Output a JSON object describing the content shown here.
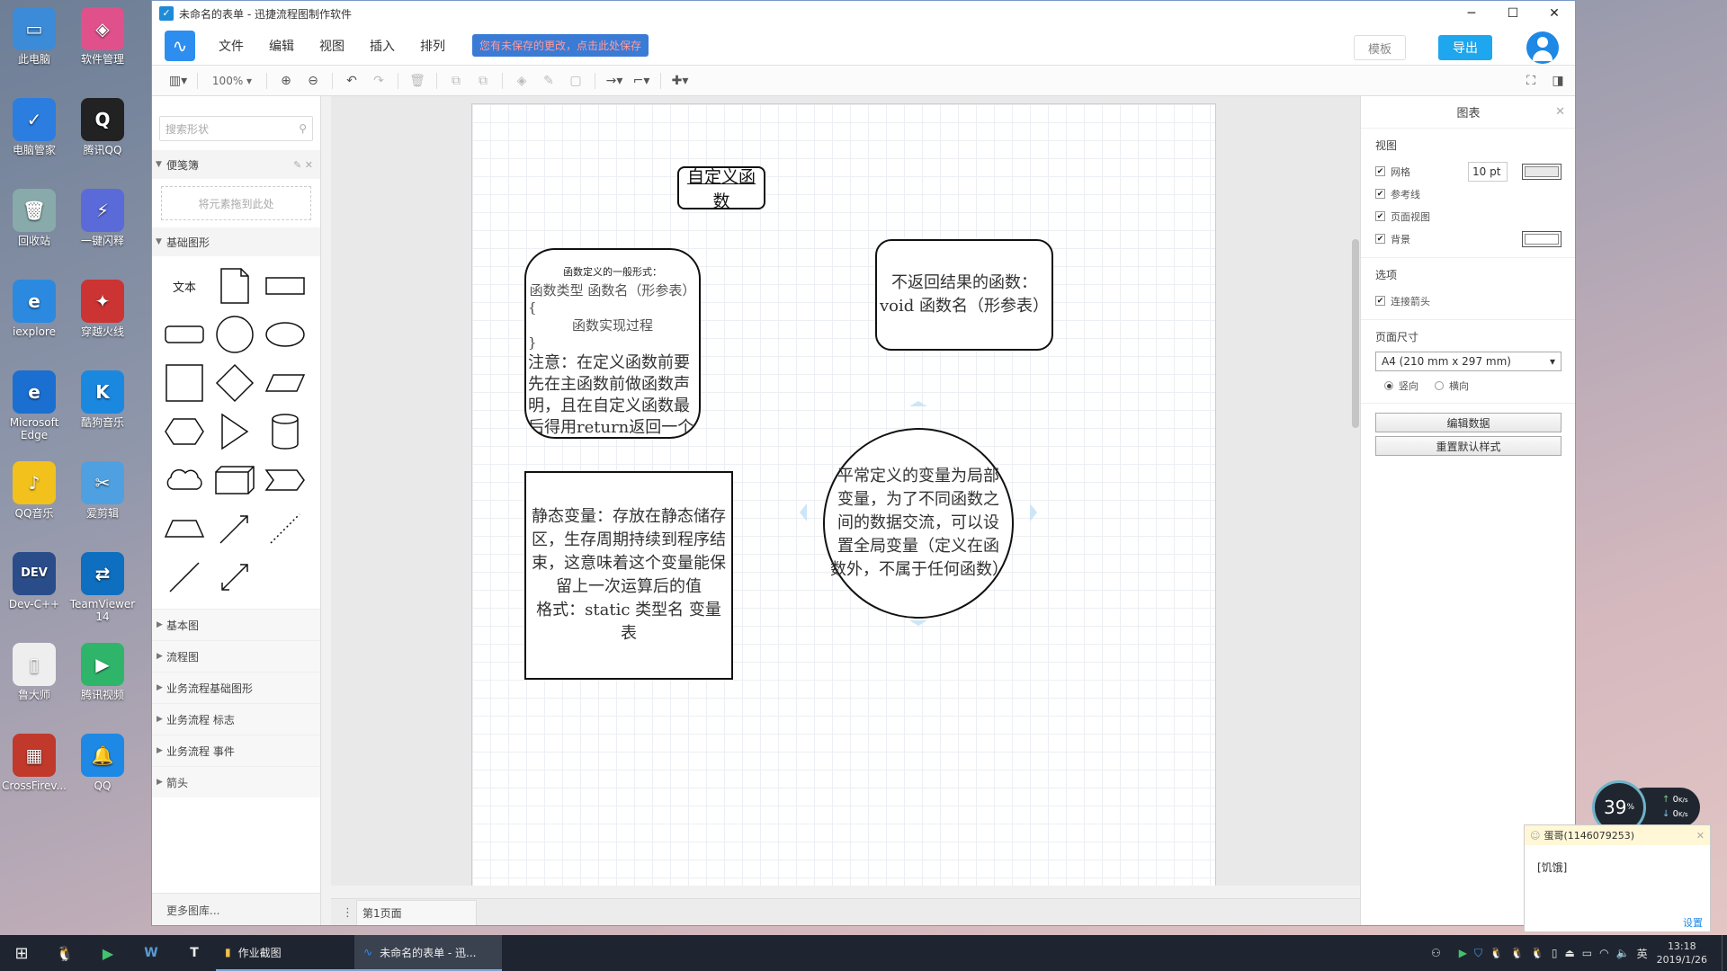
{
  "desktop": {
    "icons": [
      {
        "label": "此电脑",
        "color": "#3b8bd9",
        "glyph": "▭"
      },
      {
        "label": "软件管理",
        "color": "#e0508a",
        "glyph": "◈"
      },
      {
        "label": "电脑管家",
        "color": "#2b7de0",
        "glyph": "✓"
      },
      {
        "label": "腾讯QQ",
        "color": "#222",
        "glyph": "Q"
      },
      {
        "label": "回收站",
        "color": "#8aa",
        "glyph": "🗑"
      },
      {
        "label": "一键闪释",
        "color": "#5a6ad8",
        "glyph": "⚡"
      },
      {
        "label": "iexplore",
        "color": "#2b8ae0",
        "glyph": "e"
      },
      {
        "label": "穿越火线",
        "color": "#c33",
        "glyph": "✦"
      },
      {
        "label": "Microsoft Edge",
        "color": "#1a6fd1",
        "glyph": "e"
      },
      {
        "label": "酷狗音乐",
        "color": "#1b88e0",
        "glyph": "K"
      },
      {
        "label": "QQ音乐",
        "color": "#f2c11c",
        "glyph": "♪"
      },
      {
        "label": "爱剪辑",
        "color": "#4fa0e0",
        "glyph": "✂"
      },
      {
        "label": "Dev-C++",
        "color": "#2a4d8a",
        "glyph": "DEV"
      },
      {
        "label": "TeamViewer 14",
        "color": "#0e6ebf",
        "glyph": "⇄"
      },
      {
        "label": "鲁大师",
        "color": "#eee",
        "glyph": "▯"
      },
      {
        "label": "腾讯视频",
        "color": "#2fb56a",
        "glyph": "▶"
      },
      {
        "label": "CrossFirev...",
        "color": "#c0392b",
        "glyph": "▦"
      },
      {
        "label": "QQ",
        "color": "#1e88e5",
        "glyph": "🔔"
      }
    ]
  },
  "app": {
    "window_title": "未命名的表单 - 迅捷流程图制作软件",
    "menu": [
      "文件",
      "编辑",
      "视图",
      "插入",
      "排列"
    ],
    "notice": "您有未保存的更改，点击此处保存",
    "template_btn": "模板",
    "export_btn": "导出",
    "zoom": "100%"
  },
  "left": {
    "search_placeholder": "搜索形状",
    "scratchpad_title": "便笺簿",
    "scratchpad_hint": "将元素拖到此处",
    "basic_title": "基础图形",
    "text_shape": "文本",
    "categories": [
      "基本图",
      "流程图",
      "业务流程基础图形",
      "业务流程 标志",
      "业务流程 事件",
      "箭头"
    ],
    "more": "更多图库..."
  },
  "diagram": {
    "title": "自定义函数",
    "box1": {
      "small": "函数定义的一般形式：",
      "line1": "函数类型  函数名（形参表）",
      "line2": "{",
      "line3": "函数实现过程",
      "line4": "}",
      "note": "注意：在定义函数前要先在主函数前做函数声明，且在自定义函数最后得用return返回一个值"
    },
    "box2": {
      "line1": "不返回结果的函数：",
      "line2": "void  函数名（形参表）"
    },
    "box3": {
      "text": "静态变量：存放在静态储存区，生存周期持续到程序结束，这意味着这个变量能保留上一次运算后的值",
      "format": "格式：static  类型名  变量表"
    },
    "circle": {
      "text": "平常定义的变量为局部变量，为了不同函数之间的数据交流，可以设置全局变量（定义在函数外，不属于任何函数）"
    }
  },
  "pagebar": {
    "page1": "第1页面"
  },
  "right": {
    "title": "图表",
    "view_title": "视图",
    "grid": "网格",
    "grid_size": "10 pt",
    "guides": "参考线",
    "page_view": "页面视图",
    "background": "背景",
    "options_title": "选项",
    "connect_arrows": "连接箭头",
    "page_size_title": "页面尺寸",
    "page_size": "A4 (210 mm x 297 mm)",
    "portrait": "竖向",
    "landscape": "横向",
    "edit_data": "编辑数据",
    "reset_style": "重置默认样式"
  },
  "taskbar": {
    "folder": "作业截图",
    "active": "未命名的表单 - 迅...",
    "lang": "英",
    "time": "13:18",
    "date": "2019/1/26"
  },
  "netmon": {
    "percent": "39",
    "pct_sign": "%",
    "up": "0",
    "down": "0",
    "unit": "K/s"
  },
  "qq_popup": {
    "title": "蛋哥(1146079253)",
    "message": "[饥饿]",
    "settings": "设置"
  }
}
